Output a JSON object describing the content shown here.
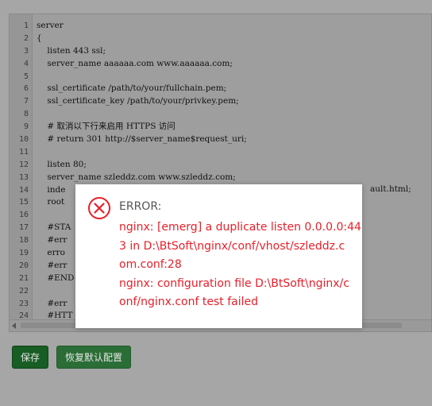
{
  "editor": {
    "lines": [
      {
        "no": "1",
        "text": "server"
      },
      {
        "no": "2",
        "text": "{"
      },
      {
        "no": "3",
        "text": "    listen 443 ssl;"
      },
      {
        "no": "4",
        "text": "    server_name aaaaaa.com www.aaaaaa.com;"
      },
      {
        "no": "5",
        "text": ""
      },
      {
        "no": "6",
        "text": "    ssl_certificate /path/to/your/fullchain.pem;"
      },
      {
        "no": "7",
        "text": "    ssl_certificate_key /path/to/your/privkey.pem;"
      },
      {
        "no": "8",
        "text": ""
      },
      {
        "no": "9",
        "text": "    # 取消以下行来启用 HTTPS 访问"
      },
      {
        "no": "10",
        "text": "    # return 301 http://$server_name$request_uri;"
      },
      {
        "no": "11",
        "text": ""
      },
      {
        "no": "12",
        "text": "    listen 80;"
      },
      {
        "no": "13",
        "text": "    server_name szleddz.com www.szleddz.com;"
      },
      {
        "no": "14",
        "text": "    inde"
      },
      {
        "no": "15",
        "text": "    root"
      },
      {
        "no": "16",
        "text": ""
      },
      {
        "no": "17",
        "text": "    #STA"
      },
      {
        "no": "18",
        "text": "    #err"
      },
      {
        "no": "19",
        "text": "    erro"
      },
      {
        "no": "20",
        "text": "    #err"
      },
      {
        "no": "21",
        "text": "    #END"
      },
      {
        "no": "22",
        "text": ""
      },
      {
        "no": "23",
        "text": "    #err"
      },
      {
        "no": "24",
        "text": "    #HTT"
      }
    ],
    "line14_right_fragment": "ault.html;"
  },
  "buttons": {
    "save_label": "保存",
    "reset_label": "恢复默认配置"
  },
  "dialog": {
    "title": "ERROR:",
    "message_lines": [
      "nginx: [emerg] a duplicate listen 0.0.0.0:44",
      "3 in D:\\BtSoft\\nginx/conf/vhost/szleddz.c",
      "om.conf:28",
      "nginx: configuration file D:\\BtSoft\\nginx/c",
      "onf/nginx.conf test failed"
    ],
    "icon": "error-circle-x-icon"
  },
  "colors": {
    "error_red": "#e8202a",
    "button_green": "#175d24",
    "overlay": "#a6a6a6"
  }
}
